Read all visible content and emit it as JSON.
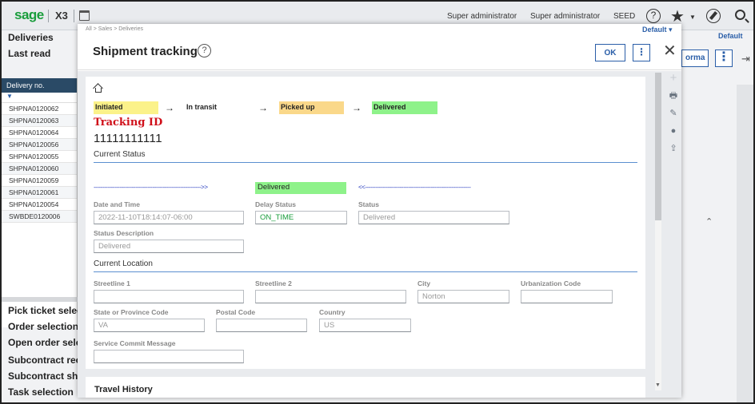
{
  "topbar": {
    "logo": "sage",
    "product": "X3",
    "user1": "Super administrator",
    "user2": "Super administrator",
    "folder": "SEED"
  },
  "background": {
    "title1": "Deliveries",
    "title2": "Last read",
    "list_header": "Delivery no.",
    "filter_icon": "filter-icon",
    "deliveries": [
      "SHPNA0120062",
      "SHPNA0120063",
      "SHPNA0120064",
      "SHPNA0120056",
      "SHPNA0120055",
      "SHPNA0120060",
      "SHPNA0120059",
      "SHPNA0120061",
      "SHPNA0120054",
      "SWBDE0120006"
    ],
    "menu": [
      "Pick ticket selec",
      "Order selection",
      "Open order selec",
      "Subcontract rec",
      "Subcontract sho",
      "Task selection"
    ],
    "default_label": "Default",
    "forma_label": "orma"
  },
  "modal": {
    "breadcrumb": "All  >  Sales  >  Deliveries",
    "default_label": "Default",
    "title": "Shipment tracking",
    "ok_label": "OK",
    "more_label": "⋮",
    "close_label": "✕",
    "progress": {
      "steps": [
        "Initiated",
        "In transit",
        "Picked up",
        "Delivered"
      ],
      "arrow": "→"
    },
    "tracking_id_label": "Tracking ID",
    "tracking_id": "11111111111",
    "current_status": {
      "section": "Current Status",
      "dash_left": "-------------------------------------------------------------->>",
      "dash_right": "<<-------------------------------------------------------------",
      "status_badge": "Delivered",
      "date_time_label": "Date and Time",
      "date_time": "2022-11-10T18:14:07-06:00",
      "delay_status_label": "Delay Status",
      "delay_status": "ON_TIME",
      "status_label": "Status",
      "status": "Delivered",
      "status_description_label": "Status Description",
      "status_description": "Delivered"
    },
    "current_location": {
      "section": "Current Location",
      "streetline1_label": "Streetline 1",
      "streetline1": "",
      "streetline2_label": "Streetline 2",
      "streetline2": "",
      "city_label": "City",
      "city": "Norton",
      "urbanization_label": "Urbanization Code",
      "urbanization": "",
      "state_label": "State or Province Code",
      "state": "VA",
      "postal_label": "Postal Code",
      "postal": "",
      "country_label": "Country",
      "country": "US",
      "service_commit_label": "Service Commit Message",
      "service_commit": ""
    },
    "travel_history": "Travel History"
  },
  "colors": {
    "accent": "#2a5ea8",
    "brand": "#1a9d3c",
    "step_initiated": "#fbf28a",
    "step_picked_up": "#fad88a",
    "step_delivered": "#8ef28a",
    "tracking_label": "#d0101a"
  }
}
